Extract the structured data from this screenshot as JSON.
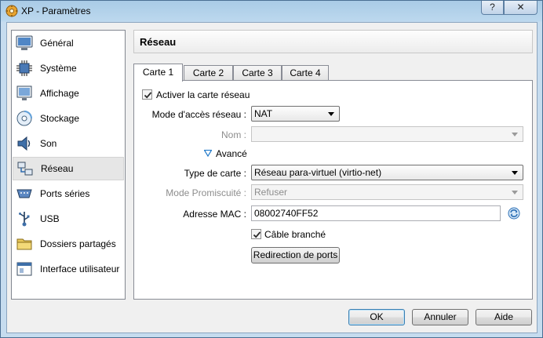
{
  "window": {
    "title": "XP - Paramètres",
    "help_label": "?",
    "close_label": "✕"
  },
  "sidebar": {
    "items": [
      {
        "label": "Général",
        "icon": "monitor-icon"
      },
      {
        "label": "Système",
        "icon": "chip-icon"
      },
      {
        "label": "Affichage",
        "icon": "display-icon"
      },
      {
        "label": "Stockage",
        "icon": "disc-icon"
      },
      {
        "label": "Son",
        "icon": "speaker-icon"
      },
      {
        "label": "Réseau",
        "icon": "network-icon",
        "selected": true
      },
      {
        "label": "Ports séries",
        "icon": "serial-port-icon"
      },
      {
        "label": "USB",
        "icon": "usb-icon"
      },
      {
        "label": "Dossiers partagés",
        "icon": "folder-icon"
      },
      {
        "label": "Interface utilisateur",
        "icon": "ui-window-icon"
      }
    ]
  },
  "panel": {
    "title": "Réseau",
    "tabs": [
      "Carte 1",
      "Carte 2",
      "Carte 3",
      "Carte 4"
    ],
    "active_tab": "Carte 1",
    "enable_adapter": {
      "label": "Activer la carte réseau",
      "checked": true
    },
    "attached_to": {
      "label": "Mode d'accès réseau :",
      "value": "NAT"
    },
    "name": {
      "label": "Nom :",
      "value": ""
    },
    "advanced": {
      "label": "Avancé"
    },
    "adapter_type": {
      "label": "Type de carte :",
      "value": "Réseau para-virtuel (virtio-net)"
    },
    "promiscuous": {
      "label": "Mode Promiscuité :",
      "value": "Refuser"
    },
    "mac": {
      "label": "Adresse MAC :",
      "value": "08002740FF52"
    },
    "cable": {
      "label": "Câble branché",
      "checked": true
    },
    "port_forwarding_label": "Redirection de ports"
  },
  "buttons": {
    "ok": "OK",
    "cancel": "Annuler",
    "help": "Aide"
  },
  "colors": {
    "selected_bg": "#e6e6e6",
    "accent_blue": "#1e78c8",
    "disabled_text": "#8d8d8d"
  }
}
